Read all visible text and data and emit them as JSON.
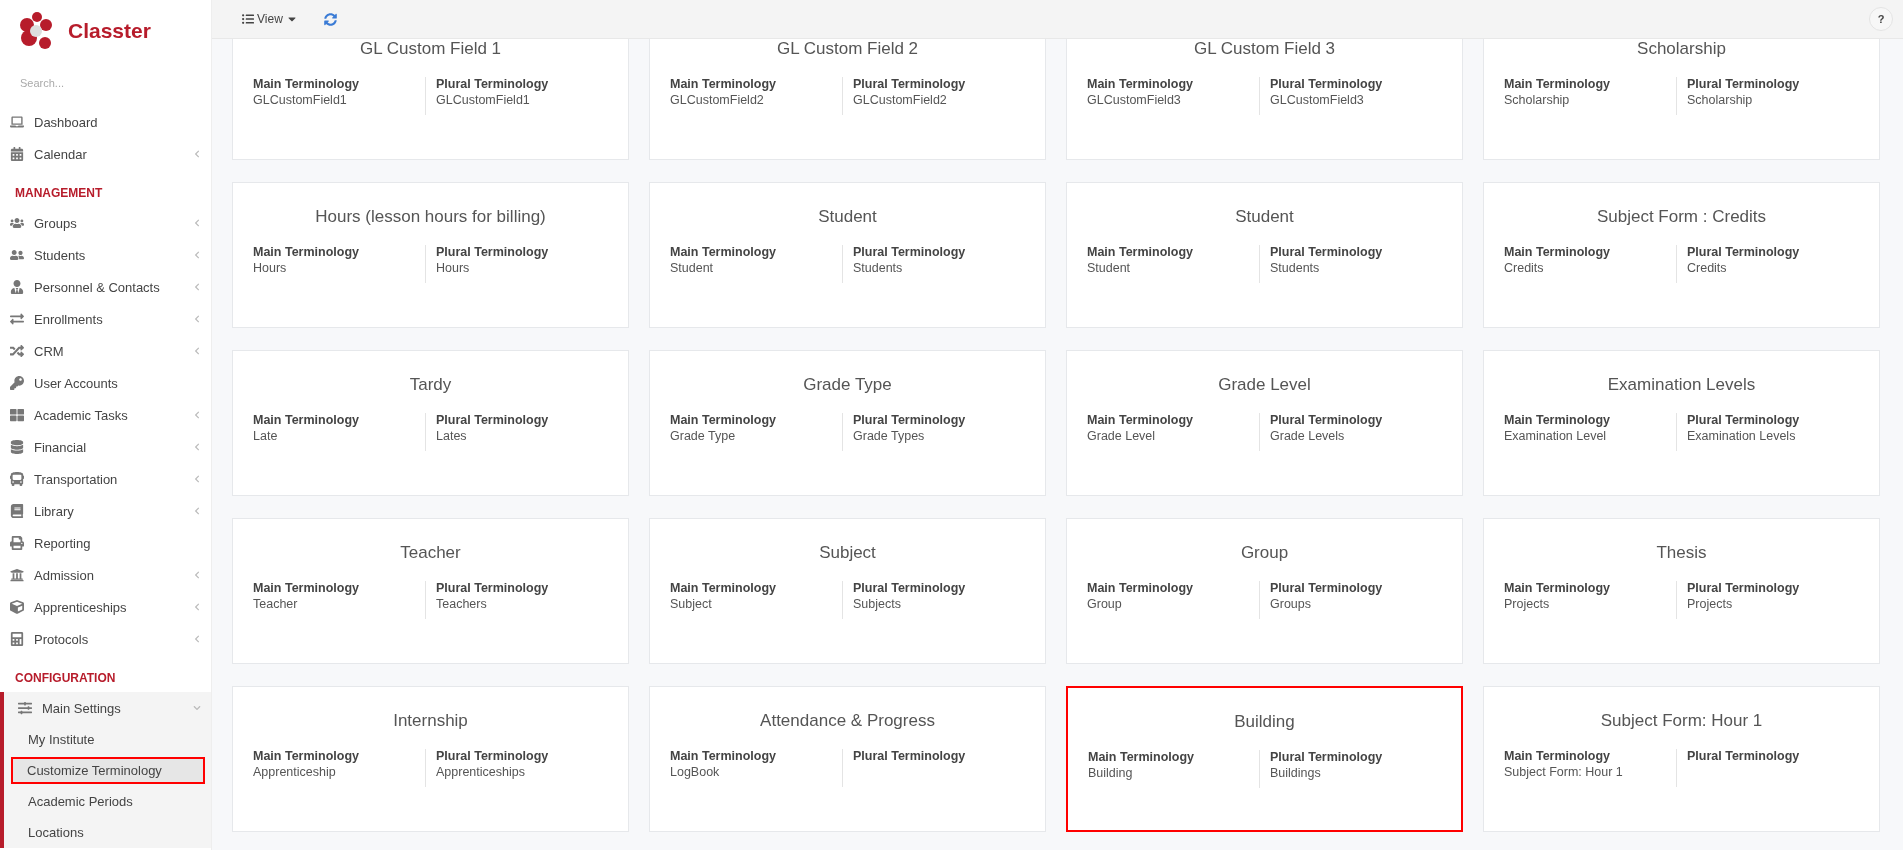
{
  "brand": {
    "name": "Classter"
  },
  "sidebar": {
    "search": {
      "placeholder": "Search..."
    },
    "groups": [
      {
        "items": [
          {
            "label": "Dashboard",
            "expandable": false,
            "expanded": false
          },
          {
            "label": "Calendar",
            "expandable": true,
            "expanded": false
          }
        ]
      },
      {
        "heading": "MANAGEMENT",
        "items": [
          {
            "label": "Groups",
            "expandable": true,
            "expanded": false
          },
          {
            "label": "Students",
            "expandable": true,
            "expanded": false
          },
          {
            "label": "Personnel & Contacts",
            "expandable": true,
            "expanded": false
          },
          {
            "label": "Enrollments",
            "expandable": true,
            "expanded": false
          },
          {
            "label": "CRM",
            "expandable": true,
            "expanded": false
          },
          {
            "label": "User Accounts",
            "expandable": false,
            "expanded": false
          },
          {
            "label": "Academic Tasks",
            "expandable": true,
            "expanded": false
          },
          {
            "label": "Financial",
            "expandable": true,
            "expanded": false
          },
          {
            "label": "Transportation",
            "expandable": true,
            "expanded": false
          },
          {
            "label": "Library",
            "expandable": true,
            "expanded": false
          },
          {
            "label": "Reporting",
            "expandable": false,
            "expanded": false
          },
          {
            "label": "Admission",
            "expandable": true,
            "expanded": false
          },
          {
            "label": "Apprenticeships",
            "expandable": true,
            "expanded": false
          },
          {
            "label": "Protocols",
            "expandable": true,
            "expanded": false
          }
        ]
      },
      {
        "heading": "CONFIGURATION",
        "items": [
          {
            "label": "Main Settings",
            "expandable": true,
            "expanded": true,
            "children": [
              {
                "label": "My Institute",
                "selected": false
              },
              {
                "label": "Customize Terminology",
                "selected": true
              },
              {
                "label": "Academic Periods",
                "selected": false
              },
              {
                "label": "Locations",
                "selected": false
              }
            ]
          }
        ]
      }
    ]
  },
  "toolbar": {
    "view_button": "View",
    "help_button": "?"
  },
  "cards": [
    {
      "title": "GL Custom Field 1",
      "main_label": "Main Terminology",
      "main_value": "GLCustomField1",
      "plural_label": "Plural Terminology",
      "plural_value": "GLCustomField1",
      "highlighted": false
    },
    {
      "title": "GL Custom Field 2",
      "main_label": "Main Terminology",
      "main_value": "GLCustomField2",
      "plural_label": "Plural Terminology",
      "plural_value": "GLCustomField2",
      "highlighted": false
    },
    {
      "title": "GL Custom Field 3",
      "main_label": "Main Terminology",
      "main_value": "GLCustomField3",
      "plural_label": "Plural Terminology",
      "plural_value": "GLCustomField3",
      "highlighted": false
    },
    {
      "title": "Scholarship",
      "main_label": "Main Terminology",
      "main_value": "Scholarship",
      "plural_label": "Plural Terminology",
      "plural_value": "Scholarship",
      "highlighted": false
    },
    {
      "title": "Hours (lesson hours for billing)",
      "main_label": "Main Terminology",
      "main_value": "Hours",
      "plural_label": "Plural Terminology",
      "plural_value": "Hours",
      "highlighted": false
    },
    {
      "title": "Student",
      "main_label": "Main Terminology",
      "main_value": "Student",
      "plural_label": "Plural Terminology",
      "plural_value": "Students",
      "highlighted": false
    },
    {
      "title": "Student",
      "main_label": "Main Terminology",
      "main_value": "Student",
      "plural_label": "Plural Terminology",
      "plural_value": "Students",
      "highlighted": false
    },
    {
      "title": "Subject Form : Credits",
      "main_label": "Main Terminology",
      "main_value": "Credits",
      "plural_label": "Plural Terminology",
      "plural_value": "Credits",
      "highlighted": false
    },
    {
      "title": "Tardy",
      "main_label": "Main Terminology",
      "main_value": "Late",
      "plural_label": "Plural Terminology",
      "plural_value": "Lates",
      "highlighted": false
    },
    {
      "title": "Grade Type",
      "main_label": "Main Terminology",
      "main_value": "Grade Type",
      "plural_label": "Plural Terminology",
      "plural_value": "Grade Types",
      "highlighted": false
    },
    {
      "title": "Grade Level",
      "main_label": "Main Terminology",
      "main_value": "Grade Level",
      "plural_label": "Plural Terminology",
      "plural_value": "Grade Levels",
      "highlighted": false
    },
    {
      "title": "Examination Levels",
      "main_label": "Main Terminology",
      "main_value": "Examination Level",
      "plural_label": "Plural Terminology",
      "plural_value": "Examination Levels",
      "highlighted": false
    },
    {
      "title": "Teacher",
      "main_label": "Main Terminology",
      "main_value": "Teacher",
      "plural_label": "Plural Terminology",
      "plural_value": "Teachers",
      "highlighted": false
    },
    {
      "title": "Subject",
      "main_label": "Main Terminology",
      "main_value": "Subject",
      "plural_label": "Plural Terminology",
      "plural_value": "Subjects",
      "highlighted": false
    },
    {
      "title": "Group",
      "main_label": "Main Terminology",
      "main_value": "Group",
      "plural_label": "Plural Terminology",
      "plural_value": "Groups",
      "highlighted": false
    },
    {
      "title": "Thesis",
      "main_label": "Main Terminology",
      "main_value": "Projects",
      "plural_label": "Plural Terminology",
      "plural_value": "Projects",
      "highlighted": false
    },
    {
      "title": "Internship",
      "main_label": "Main Terminology",
      "main_value": "Apprenticeship",
      "plural_label": "Plural Terminology",
      "plural_value": "Apprenticeships",
      "highlighted": false
    },
    {
      "title": "Attendance & Progress",
      "main_label": "Main Terminology",
      "main_value": "LogBook",
      "plural_label": "Plural Terminology",
      "highlighted": false
    },
    {
      "title": "Building",
      "main_label": "Main Terminology",
      "main_value": "Building",
      "plural_label": "Plural Terminology",
      "plural_value": "Buildings",
      "highlighted": true
    },
    {
      "title": "Subject Form: Hour 1",
      "main_label": "Main Terminology",
      "main_value": "Subject Form: Hour 1",
      "plural_label": "Plural Terminology",
      "highlighted": false
    }
  ]
}
